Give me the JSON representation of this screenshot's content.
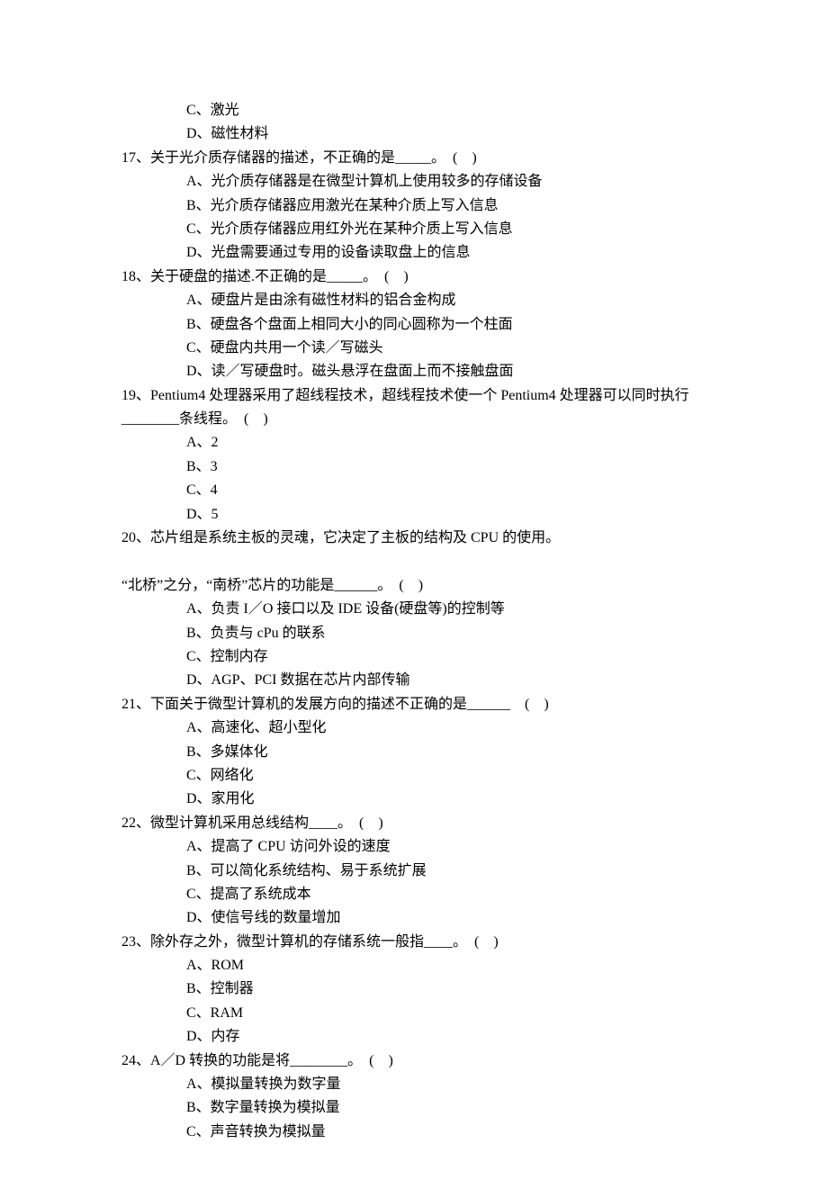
{
  "lines": [
    {
      "cls": "option",
      "t": "C、激光"
    },
    {
      "cls": "option",
      "t": "D、磁性材料"
    },
    {
      "cls": "question",
      "t": "17、关于光介质存储器的描述，不正确的是_____。　(　)"
    },
    {
      "cls": "option",
      "t": "A、光介质存储器是在微型计算机上使用较多的存储设备"
    },
    {
      "cls": "option",
      "t": "B、光介质存储器应用激光在某种介质上写入信息"
    },
    {
      "cls": "option",
      "t": "C、光介质存储器应用红外光在某种介质上写入信息"
    },
    {
      "cls": "option",
      "t": "D、光盘需要通过专用的设备读取盘上的信息"
    },
    {
      "cls": "question",
      "t": "18、关于硬盘的描述.不正确的是_____。　(　)"
    },
    {
      "cls": "option",
      "t": "A、硬盘片是由涂有磁性材料的铝合金构成"
    },
    {
      "cls": "option",
      "t": "B、硬盘各个盘面上相同大小的同心圆称为一个柱面"
    },
    {
      "cls": "option",
      "t": "C、硬盘内共用一个读／写磁头"
    },
    {
      "cls": "option",
      "t": "D、读／写硬盘时。磁头悬浮在盘面上而不接触盘面"
    },
    {
      "cls": "question",
      "t": "19、Pentium4 处理器采用了超线程技术，超线程技术使一个 Pentium4 处理器可以同时执行"
    },
    {
      "cls": "question continuation",
      "t": "________条线程。　(　)"
    },
    {
      "cls": "option",
      "t": "A、2"
    },
    {
      "cls": "option",
      "t": "B、3"
    },
    {
      "cls": "option",
      "t": "C、4"
    },
    {
      "cls": "option",
      "t": "D、5"
    },
    {
      "cls": "question",
      "t": "20、芯片组是系统主板的灵魂，它决定了主板的结构及 CPU 的使用。"
    },
    {
      "cls": "question noindent",
      "t": " "
    },
    {
      "cls": "question noindent",
      "t": "“北桥”之分，“南桥”芯片的功能是______。　(　)"
    },
    {
      "cls": "option",
      "t": "A、负责 I／O 接口以及 IDE 设备(硬盘等)的控制等"
    },
    {
      "cls": "option",
      "t": "B、负责与 cPu 的联系"
    },
    {
      "cls": "option",
      "t": "C、控制内存"
    },
    {
      "cls": "option",
      "t": "D、AGP、PCI 数据在芯片内部传输"
    },
    {
      "cls": "question",
      "t": "21、下面关于微型计算机的发展方向的描述不正确的是______　(　)"
    },
    {
      "cls": "option",
      "t": "A、高速化、超小型化"
    },
    {
      "cls": "option",
      "t": "B、多媒体化"
    },
    {
      "cls": "option",
      "t": "C、网络化"
    },
    {
      "cls": "option",
      "t": "D、家用化"
    },
    {
      "cls": "question",
      "t": "22、微型计算机采用总线结构____。　(　)"
    },
    {
      "cls": "option",
      "t": "A、提高了 CPU 访问外设的速度"
    },
    {
      "cls": "option",
      "t": "B、可以简化系统结构、易于系统扩展"
    },
    {
      "cls": "option",
      "t": "C、提高了系统成本"
    },
    {
      "cls": "option",
      "t": "D、使信号线的数量增加"
    },
    {
      "cls": "question",
      "t": "23、除外存之外，微型计算机的存储系统一般指____。　(　)"
    },
    {
      "cls": "option",
      "t": "A、ROM"
    },
    {
      "cls": "option",
      "t": "B、控制器"
    },
    {
      "cls": "option",
      "t": "C、RAM"
    },
    {
      "cls": "option",
      "t": "D、内存"
    },
    {
      "cls": "question",
      "t": "24、A／D 转换的功能是将________。　(　)"
    },
    {
      "cls": "option",
      "t": "A、模拟量转换为数字量"
    },
    {
      "cls": "option",
      "t": "B、数字量转换为模拟量"
    },
    {
      "cls": "option",
      "t": "C、声音转换为模拟量"
    }
  ]
}
